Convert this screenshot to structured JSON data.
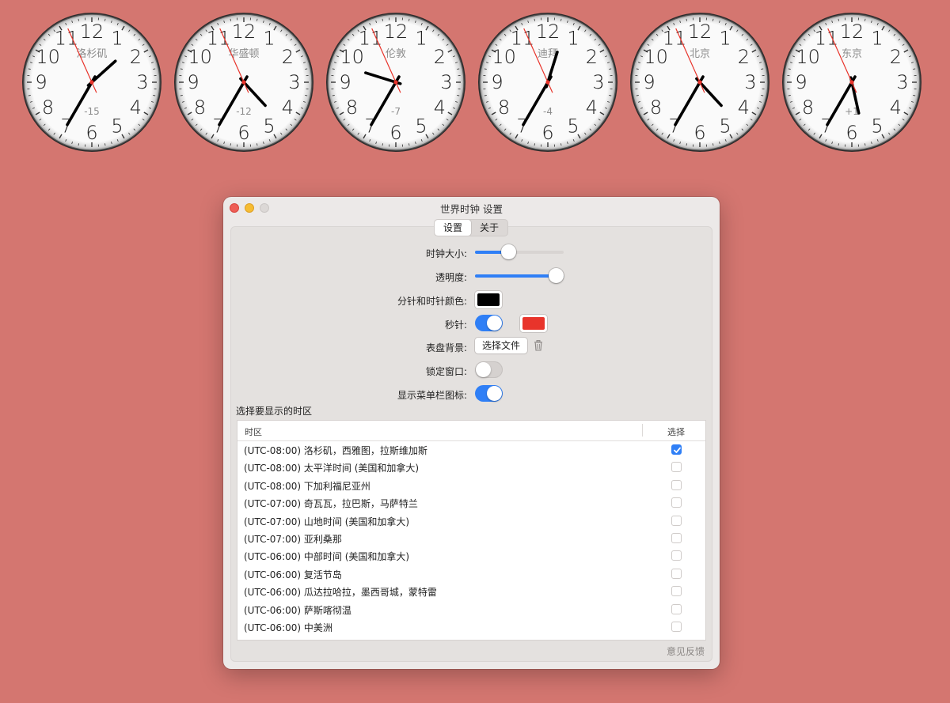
{
  "clocks": [
    {
      "city": "洛杉矶",
      "offset": "-15",
      "hour": 1.6,
      "minute": 35,
      "second": 56
    },
    {
      "city": "华盛顿",
      "offset": "-12",
      "hour": 4.58,
      "minute": 35,
      "second": 56
    },
    {
      "city": "伦敦",
      "offset": "-7",
      "hour": 9.58,
      "minute": 35,
      "second": 56
    },
    {
      "city": "迪拜",
      "offset": "-4",
      "hour": 12.58,
      "minute": 35,
      "second": 56
    },
    {
      "city": "北京",
      "offset": "",
      "hour": 4.58,
      "minute": 35,
      "second": 56
    },
    {
      "city": "东京",
      "offset": "+1",
      "hour": 5.58,
      "minute": 35,
      "second": 56
    }
  ],
  "clock_numbers": [
    "12",
    "1",
    "2",
    "3",
    "4",
    "5",
    "6",
    "7",
    "8",
    "9",
    "10",
    "11"
  ],
  "window": {
    "title": "世界时钟 设置",
    "tabs": [
      "设置",
      "关于"
    ],
    "active_tab": "设置"
  },
  "settings": {
    "clock_size_label": "时钟大小:",
    "clock_size_value": 0.36,
    "opacity_label": "透明度:",
    "opacity_value": 1.0,
    "hand_color_label": "分针和时针颜色:",
    "hand_color": "#000000",
    "second_hand_label": "秒针:",
    "second_hand_on": true,
    "second_hand_color": "#e8342b",
    "dial_bg_label": "表盘背景:",
    "choose_file_label": "选择文件",
    "lock_window_label": "锁定窗口:",
    "lock_window_on": false,
    "menu_icon_label": "显示菜单栏图标:",
    "menu_icon_on": true
  },
  "timezones": {
    "heading": "选择要显示的时区",
    "col_zone": "时区",
    "col_select": "选择",
    "rows": [
      {
        "name": "(UTC-08:00) 洛杉矶，西雅图，拉斯维加斯",
        "checked": true
      },
      {
        "name": "(UTC-08:00) 太平洋时间 (美国和加拿大)",
        "checked": false
      },
      {
        "name": "(UTC-08:00) 下加利福尼亚州",
        "checked": false
      },
      {
        "name": "(UTC-07:00) 奇瓦瓦，拉巴斯，马萨特兰",
        "checked": false
      },
      {
        "name": "(UTC-07:00) 山地时间 (美国和加拿大)",
        "checked": false
      },
      {
        "name": "(UTC-07:00) 亚利桑那",
        "checked": false
      },
      {
        "name": "(UTC-06:00) 中部时间 (美国和加拿大)",
        "checked": false
      },
      {
        "name": "(UTC-06:00) 复活节岛",
        "checked": false
      },
      {
        "name": "(UTC-06:00) 瓜达拉哈拉，墨西哥城，蒙特雷",
        "checked": false
      },
      {
        "name": "(UTC-06:00) 萨斯喀彻温",
        "checked": false
      },
      {
        "name": "(UTC-06:00) 中美洲",
        "checked": false
      }
    ]
  },
  "feedback_label": "意见反馈",
  "colors": {
    "desktop": "#d47670",
    "accent": "#2f7ff6",
    "second_hand": "#e8342b"
  }
}
